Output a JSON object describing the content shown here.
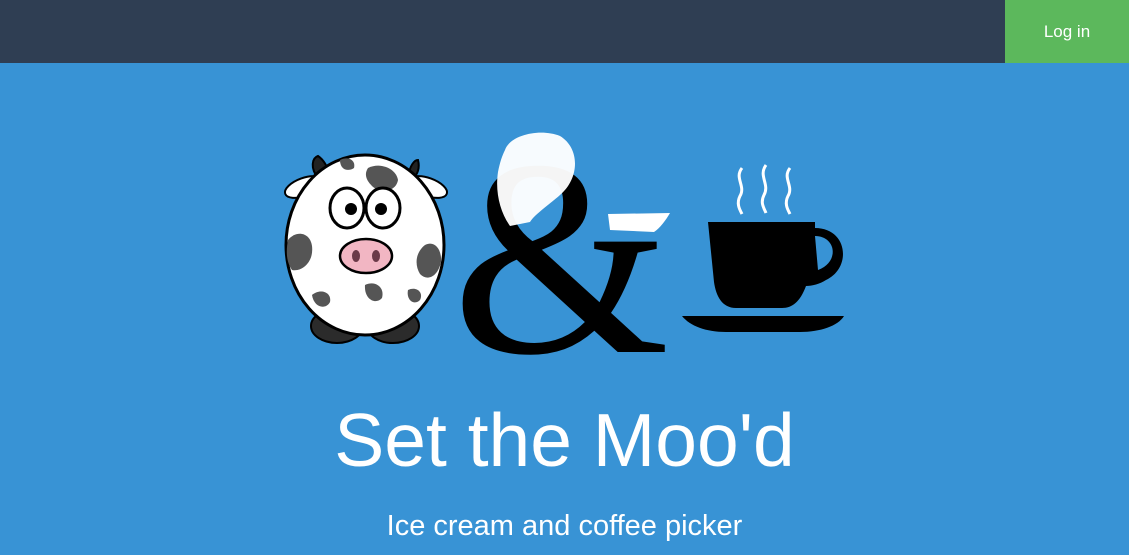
{
  "nav": {
    "login_label": "Log in"
  },
  "hero": {
    "title": "Set the Moo'd",
    "subtitle": "Ice cream and coffee picker",
    "logo_icons": [
      "cow-icon",
      "ampersand-icon",
      "coffee-cup-icon"
    ]
  },
  "colors": {
    "navbar": "#2f3e53",
    "login_button": "#5cb85c",
    "hero_background": "#3893d5",
    "text": "#ffffff"
  }
}
